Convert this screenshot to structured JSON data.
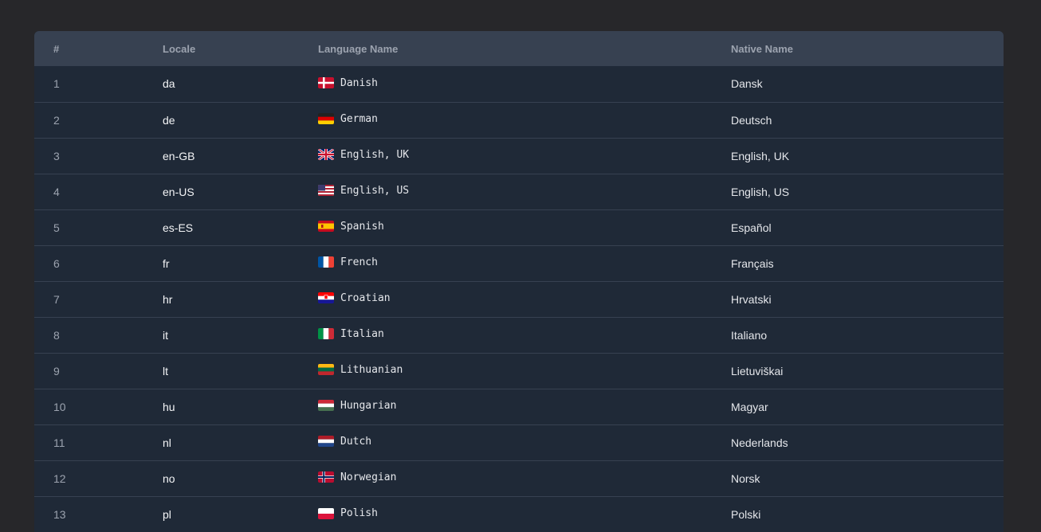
{
  "table": {
    "headers": {
      "index": "#",
      "locale": "Locale",
      "language": "Language Name",
      "native": "Native Name"
    },
    "rows": [
      {
        "index": "1",
        "locale": "da",
        "language": "Danish",
        "native": "Dansk",
        "flag": "denmark-flag-icon"
      },
      {
        "index": "2",
        "locale": "de",
        "language": "German",
        "native": "Deutsch",
        "flag": "germany-flag-icon"
      },
      {
        "index": "3",
        "locale": "en-GB",
        "language": "English, UK",
        "native": "English, UK",
        "flag": "uk-flag-icon"
      },
      {
        "index": "4",
        "locale": "en-US",
        "language": "English, US",
        "native": "English, US",
        "flag": "us-flag-icon"
      },
      {
        "index": "5",
        "locale": "es-ES",
        "language": "Spanish",
        "native": "Español",
        "flag": "spain-flag-icon"
      },
      {
        "index": "6",
        "locale": "fr",
        "language": "French",
        "native": "Français",
        "flag": "france-flag-icon"
      },
      {
        "index": "7",
        "locale": "hr",
        "language": "Croatian",
        "native": "Hrvatski",
        "flag": "croatia-flag-icon"
      },
      {
        "index": "8",
        "locale": "it",
        "language": "Italian",
        "native": "Italiano",
        "flag": "italy-flag-icon"
      },
      {
        "index": "9",
        "locale": "lt",
        "language": "Lithuanian",
        "native": "Lietuviškai",
        "flag": "lithuania-flag-icon"
      },
      {
        "index": "10",
        "locale": "hu",
        "language": "Hungarian",
        "native": "Magyar",
        "flag": "hungary-flag-icon"
      },
      {
        "index": "11",
        "locale": "nl",
        "language": "Dutch",
        "native": "Nederlands",
        "flag": "netherlands-flag-icon"
      },
      {
        "index": "12",
        "locale": "no",
        "language": "Norwegian",
        "native": "Norsk",
        "flag": "norway-flag-icon"
      },
      {
        "index": "13",
        "locale": "pl",
        "language": "Polish",
        "native": "Polski",
        "flag": "poland-flag-icon"
      }
    ]
  },
  "colors": {
    "page_background": "#27272a",
    "table_background": "#1f2937",
    "header_background": "#374151",
    "header_text": "#9ca3af",
    "row_divider": "#374151"
  }
}
